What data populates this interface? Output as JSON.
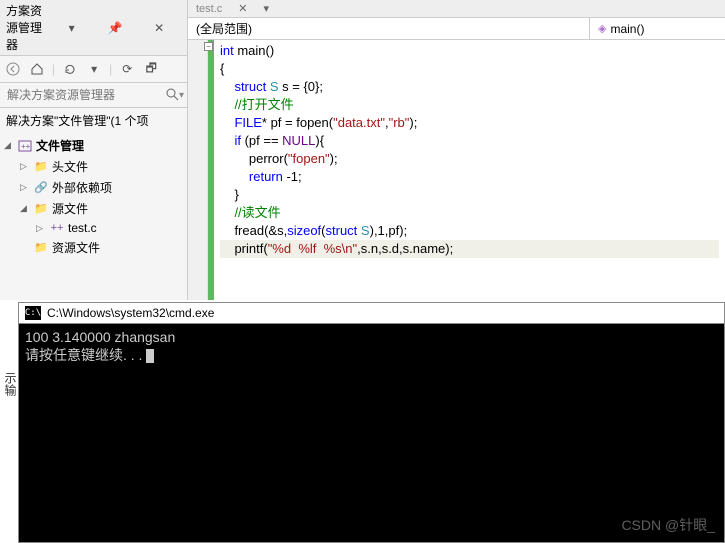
{
  "panel": {
    "title": "方案资源管理器",
    "search_placeholder": "解决方案资源管理器",
    "solution_text": "解决方案\"文件管理\"(1 个项"
  },
  "tree": {
    "project": "文件管理",
    "headers": "头文件",
    "external": "外部依赖项",
    "source": "源文件",
    "testc": "test.c",
    "resource": "资源文件"
  },
  "editor": {
    "tab_close": "✕",
    "scope_left": "(全局范围)",
    "scope_right": "main()"
  },
  "code": {
    "l1a": "int",
    "l1b": " main()",
    "l2": "{",
    "l3a": "    struct",
    "l3b": " S",
    "l3c": " s = {0};",
    "l4": "    //打开文件",
    "l5a": "    FILE",
    "l5b": "* pf = fopen(",
    "l5c": "\"data.txt\"",
    "l5d": ",",
    "l5e": "\"rb\"",
    "l5f": ");",
    "l6a": "    if",
    "l6b": " (pf == ",
    "l6c": "NULL",
    "l6d": "){",
    "l7a": "        perror(",
    "l7b": "\"fopen\"",
    "l7c": ");",
    "l8a": "        return",
    "l8b": " -1;",
    "l9": "    }",
    "l10": "    //读文件",
    "l11a": "    fread(&s,",
    "l11b": "sizeof",
    "l11c": "(",
    "l11d": "struct",
    "l11e": " S",
    "l11f": "),1,pf);",
    "l12a": "    printf(",
    "l12b": "\"%d  %lf  %s\\n\"",
    "l12c": ",s.n,s.d,s.name);"
  },
  "console": {
    "title": "C:\\Windows\\system32\\cmd.exe",
    "line1": "100  3.140000   zhangsan",
    "line2": "请按任意键继续. . ."
  },
  "side_tab": "示输",
  "watermark": "CSDN @针眼_"
}
